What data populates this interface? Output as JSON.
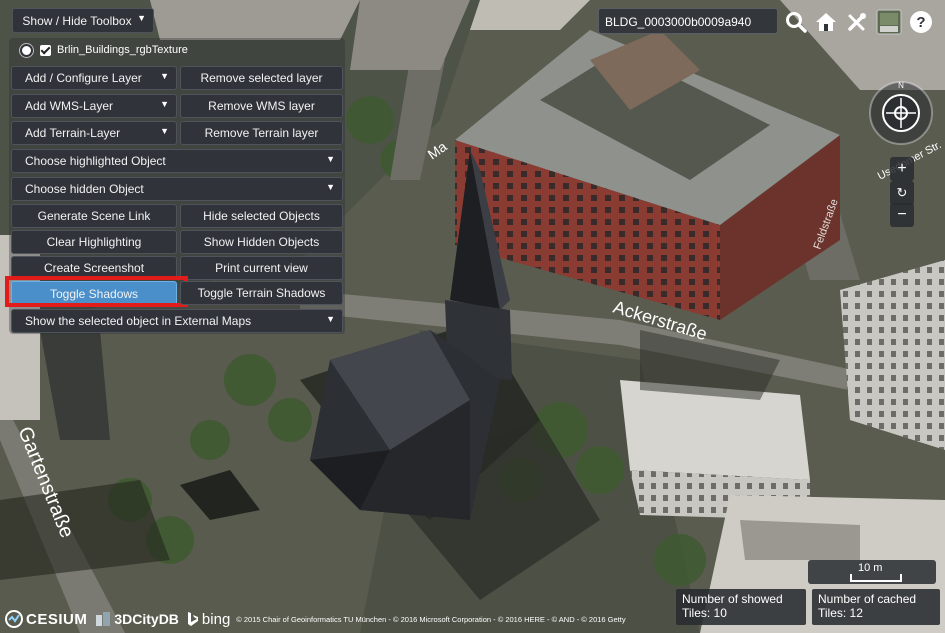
{
  "toolbox": {
    "show_hide": "Show / Hide Toolbox",
    "layer_name": "Brlin_Buildings_rgbTexture",
    "add_configure_layer": "Add / Configure Layer",
    "remove_selected_layer": "Remove selected layer",
    "add_wms_layer": "Add WMS-Layer",
    "remove_wms_layer": "Remove WMS layer",
    "add_terrain_layer": "Add Terrain-Layer",
    "remove_terrain_layer": "Remove Terrain layer",
    "choose_highlighted": "Choose highlighted Object",
    "choose_hidden": "Choose hidden Object",
    "generate_scene_link": "Generate Scene Link",
    "hide_selected": "Hide selected Objects",
    "clear_highlighting": "Clear Highlighting",
    "show_hidden": "Show Hidden Objects",
    "create_screenshot": "Create Screenshot",
    "print_view": "Print current view",
    "toggle_shadows": "Toggle Shadows",
    "toggle_terrain_shadows": "Toggle Terrain Shadows",
    "external_maps": "Show the selected object in External Maps"
  },
  "search": {
    "value": "BLDG_0003000b0009a940"
  },
  "icons": [
    "search-icon",
    "home-icon",
    "tools-icon",
    "base-layer-icon",
    "help-icon"
  ],
  "map_labels": {
    "street_1": "Gartenstraße",
    "street_2": "Ackerstraße",
    "street_3": "Feldstraße",
    "street_4": "Usedomer Str.",
    "street_5": "Ma",
    "compass_n": "N"
  },
  "navigation": {
    "zoom_in": "+",
    "reset": "↻",
    "zoom_out": "−"
  },
  "scale": {
    "label": "10 m"
  },
  "status": {
    "showed_tiles_label": "Number of showed",
    "showed_tiles_value": "Tiles: 10",
    "cached_tiles_label": "Number of cached",
    "cached_tiles_value": "Tiles: 12"
  },
  "credits": {
    "cesium": "CESIUM",
    "citydb": "3DCityDB",
    "bing": "bing",
    "text": "© 2015 Chair of Geoinformatics TU München - © 2016 Microsoft Corporation - © 2016 HERE - © AND - © 2016 Getty"
  },
  "colors": {
    "button_bg": "#30333a",
    "active_button": "#4a8fc9",
    "highlight_border": "#e21b1b"
  }
}
